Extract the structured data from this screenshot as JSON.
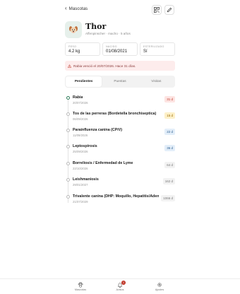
{
  "header": {
    "back_label": "Mascotas",
    "qr_icon": "qr-icon",
    "edit_icon": "pencil-icon"
  },
  "pet": {
    "name": "Thor",
    "subtitle": "Affenpinscher · macho · 5 años",
    "avatar_icon": "dog-face-icon"
  },
  "info": [
    {
      "label": "PESO",
      "value": "4.2 kg"
    },
    {
      "label": "NACIDO",
      "value": "01/08/2021"
    },
    {
      "label": "ESTERILIZADO",
      "value": "Sí"
    }
  ],
  "alert": {
    "icon": "warning-triangle-icon",
    "text": "Rabia venció el 20/07/2026. Hace 31 días."
  },
  "tabs": [
    {
      "label": "Pendientes",
      "active": true
    },
    {
      "label": "Puestas",
      "active": false
    },
    {
      "label": "Visitas",
      "active": false
    }
  ],
  "vaccines": [
    {
      "name": "Rabia",
      "date": "20/07/2026",
      "badge": "31 d",
      "badge_bg": "#fde4e2",
      "badge_color": "#c0392b"
    },
    {
      "name": "Tos de las perreras (Bordetella bronchiseptica)",
      "date": "06/09/2026",
      "badge": "15 d",
      "badge_bg": "#fdf0c8",
      "badge_color": "#9a6a00"
    },
    {
      "name": "Parainfluenza canina (CPiV)",
      "date": "11/09/2026",
      "badge": "22 d",
      "badge_bg": "#e3eef9",
      "badge_color": "#2a5d8f"
    },
    {
      "name": "Leptospirosis",
      "date": "25/09/2026",
      "badge": "36 d",
      "badge_bg": "#e3eef9",
      "badge_color": "#2a5d8f"
    },
    {
      "name": "Borreliosis / Enfermedad de Lyme",
      "date": "22/10/2026",
      "badge": "64 d",
      "badge_bg": "#f2f2f2",
      "badge_color": "#777777"
    },
    {
      "name": "Leishmaniosis",
      "date": "29/01/2027",
      "badge": "162 d",
      "badge_bg": "#f2f2f2",
      "badge_color": "#777777"
    },
    {
      "name": "Trivalente canina (DHP: Moquillo, Hepatitis/Adeno...",
      "date": "21/07/2029",
      "badge": "1066 d",
      "badge_bg": "#f2f2f2",
      "badge_color": "#777777"
    }
  ],
  "nav": [
    {
      "label": "Mascotas",
      "icon": "paw-icon"
    },
    {
      "label": "Avisos",
      "icon": "bell-icon",
      "badge": "1"
    },
    {
      "label": "Ajustes",
      "icon": "gear-icon"
    }
  ],
  "colors": {
    "accent": "#2f7d5a",
    "alert_bg": "#fdecec",
    "alert_text": "#8a3a3a"
  }
}
